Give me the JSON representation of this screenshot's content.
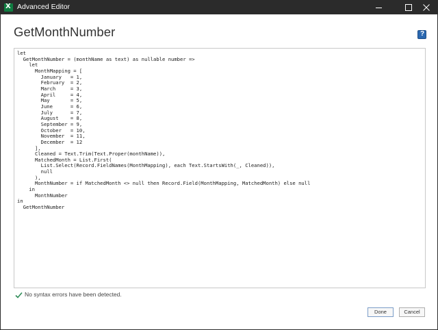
{
  "window": {
    "title": "Advanced Editor",
    "app_icon": "excel-icon"
  },
  "editor": {
    "query_name": "GetMonthNumber",
    "help_icon": "help-icon",
    "help_label": "?",
    "code": "let\n  GetMonthNumber = (monthName as text) as nullable number =>\n    let\n      MonthMapping = [\n        January   = 1,\n        February  = 2,\n        March     = 3,\n        April     = 4,\n        May       = 5,\n        June      = 6,\n        July      = 7,\n        August    = 8,\n        September = 9,\n        October   = 10,\n        November  = 11,\n        December  = 12\n      ],\n      Cleaned = Text.Trim(Text.Proper(monthName)),\n      MatchedMonth = List.First(\n        List.Select(Record.FieldNames(MonthMapping), each Text.StartsWith(_, Cleaned)),\n        null\n      ),\n      MonthNumber = if MatchedMonth <> null then Record.Field(MonthMapping, MatchedMonth) else null\n    in\n      MonthNumber\nin\n  GetMonthNumber"
  },
  "status": {
    "icon": "checkmark-icon",
    "text": "No syntax errors have been detected."
  },
  "buttons": {
    "done": "Done",
    "cancel": "Cancel"
  },
  "colors": {
    "titlebar": "#2b2b2b",
    "excel_green": "#107c41",
    "check_green": "#2e8b57",
    "help_blue": "#2b68b0"
  }
}
